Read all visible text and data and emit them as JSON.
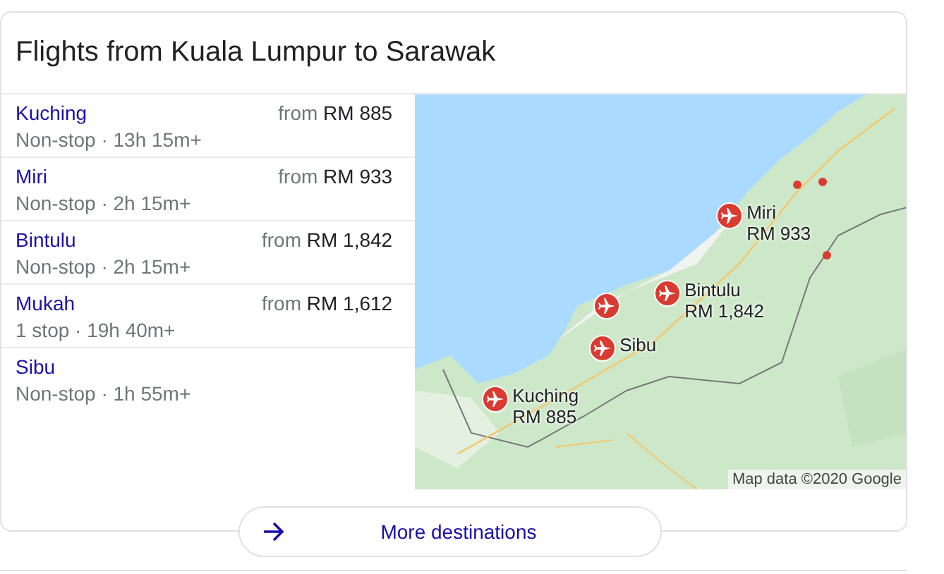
{
  "card": {
    "title": "Flights from Kuala Lumpur to Sarawak"
  },
  "flights": [
    {
      "city": "Kuching",
      "from": "from",
      "price": "RM 885",
      "details": "Non-stop · 13h 15m+"
    },
    {
      "city": "Miri",
      "from": "from",
      "price": "RM 933",
      "details": "Non-stop · 2h 15m+"
    },
    {
      "city": "Bintulu",
      "from": "from",
      "price": "RM 1,842",
      "details": "Non-stop · 2h 15m+"
    },
    {
      "city": "Mukah",
      "from": "from",
      "price": "RM 1,612",
      "details": "1 stop · 19h 40m+"
    },
    {
      "city": "Sibu",
      "details": "Non-stop · 1h 55m+"
    }
  ],
  "map": {
    "attribution": "Map data ©2020 Google",
    "pins": [
      {
        "kind": "labeled",
        "name": "Miri",
        "price": "RM 933"
      },
      {
        "kind": "labeled",
        "name": "Bintulu",
        "price": "RM 1,842"
      },
      {
        "kind": "plain"
      },
      {
        "kind": "labeled",
        "name": "Sibu"
      },
      {
        "kind": "labeled",
        "name": "Kuching",
        "price": "RM 885"
      }
    ]
  },
  "more_button": {
    "label": "More destinations"
  }
}
